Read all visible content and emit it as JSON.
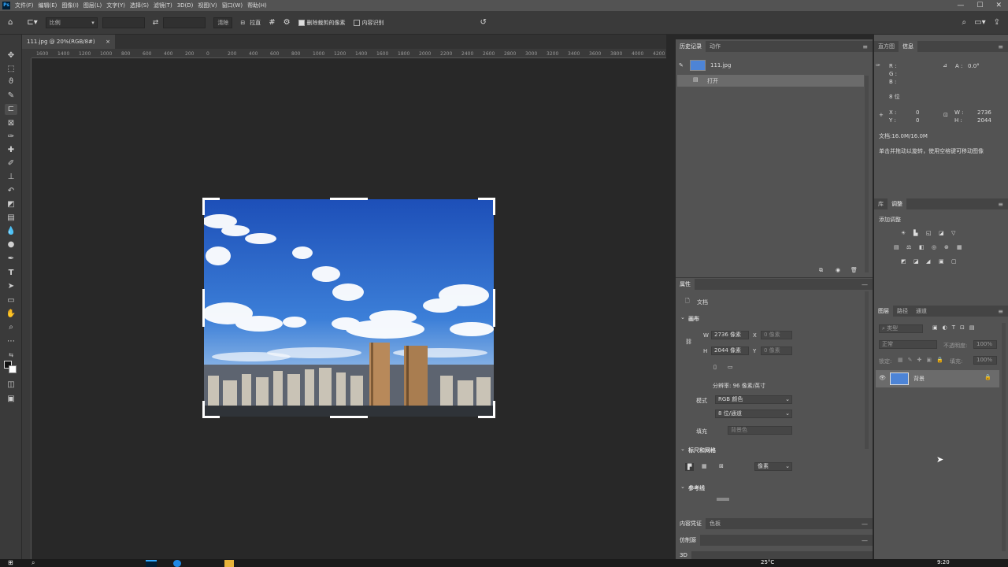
{
  "menubar": {
    "logo": "Ps",
    "items": [
      "文件(F)",
      "编辑(E)",
      "图像(I)",
      "图层(L)",
      "文字(Y)",
      "选择(S)",
      "滤镜(T)",
      "3D(D)",
      "视图(V)",
      "窗口(W)",
      "帮助(H)"
    ],
    "minimize": "—",
    "maximize": "☐",
    "close": "✕"
  },
  "options": {
    "ratio_label": "比例",
    "clear_label": "清除",
    "straighten_label": "拉直",
    "delete_cropped_label": "删除裁剪的像素",
    "delete_cropped_checked": true,
    "content_aware_label": "内容识别",
    "content_aware_checked": false
  },
  "document": {
    "tab_label": "111.jpg @ 20%(RGB/8#)",
    "tab_close": "×",
    "ruler_ticks": [
      "1600",
      "1400",
      "1200",
      "1000",
      "800",
      "600",
      "400",
      "200",
      "0",
      "200",
      "400",
      "600",
      "800",
      "1000",
      "1200",
      "1400",
      "1600",
      "1800",
      "2000",
      "2200",
      "2400",
      "2600",
      "2800",
      "3000",
      "3200",
      "3400",
      "3600",
      "3800",
      "4000",
      "4200"
    ]
  },
  "history": {
    "tabs": [
      "历史记录",
      "动作"
    ],
    "snapshot": "111.jpg",
    "open_state": "打开"
  },
  "info": {
    "tabs": [
      "直方图",
      "信息"
    ],
    "rgb": "R :\nG :\nB :",
    "angle": "A :   0.0°",
    "bit": "8 位",
    "x_label": "X :\nY :",
    "xy": "0\n0",
    "w_label": "W :\nH :",
    "wh": "2736\n2044",
    "doc_size": "文档:16.0M/16.0M",
    "hint": "单击并拖动以旋转，使用空格键可移动图像"
  },
  "adjust": {
    "tabs": [
      "库",
      "调整"
    ],
    "add_label": "添加调整"
  },
  "properties": {
    "tab": "属性",
    "doc_label": "文档",
    "canvas_header": "画布",
    "w_label": "W",
    "w_value": "2736 像素",
    "x_label": "X",
    "x_value": "0 像素",
    "h_label": "H",
    "h_value": "2044 像素",
    "y_label": "Y",
    "y_value": "0 像素",
    "resolution": "分辨率: 96 像素/英寸",
    "mode_label": "模式",
    "mode_value": "RGB 颜色",
    "depth_value": "8 位/通道",
    "fill_label": "填充",
    "fill_value": "背景色",
    "rulers_header": "标尺和网格",
    "units_value": "像素",
    "guides_header": "参考线"
  },
  "layers": {
    "tabs": [
      "图层",
      "路径",
      "通道"
    ],
    "filter_placeholder": "类型",
    "blend_mode": "正常",
    "opacity_label": "不透明度:",
    "opacity_value": "100%",
    "lock_label": "锁定:",
    "fill_label": "填充:",
    "fill_value": "100%",
    "layer_name": "背景"
  },
  "bottom_panels": {
    "row1_tabs": [
      "内容凭证",
      "色板"
    ],
    "row2_tab": "仿制源",
    "row3_tab": "3D"
  },
  "taskbar": {
    "temp": "25°C",
    "time": "9:20"
  },
  "colors": {
    "accent": "#31a8ff",
    "panel": "#535353",
    "workspace": "#282828"
  }
}
